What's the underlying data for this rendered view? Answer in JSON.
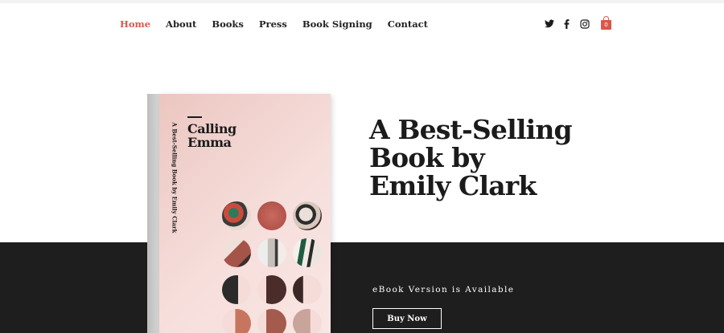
{
  "nav": {
    "items": [
      {
        "label": "Home",
        "active": true
      },
      {
        "label": "About",
        "active": false
      },
      {
        "label": "Books",
        "active": false
      },
      {
        "label": "Press",
        "active": false
      },
      {
        "label": "Book Signing",
        "active": false
      },
      {
        "label": "Contact",
        "active": false
      }
    ]
  },
  "social": [
    "twitter-icon",
    "facebook-icon",
    "instagram-icon"
  ],
  "cart": {
    "count": "0"
  },
  "book": {
    "title_line1": "Calling",
    "title_line2": "Emma",
    "side_text": "A Best-Selling Book by Emily Clark"
  },
  "hero": {
    "line1": "A Best-Selling",
    "line2": "Book by",
    "line3": "Emily Clark"
  },
  "cta": {
    "ebook_text": "eBook Version is Available",
    "buy_label": "Buy Now"
  },
  "colors": {
    "accent": "#d9584a",
    "dark_band": "#1e1e1e",
    "text": "#1b1b1b"
  }
}
